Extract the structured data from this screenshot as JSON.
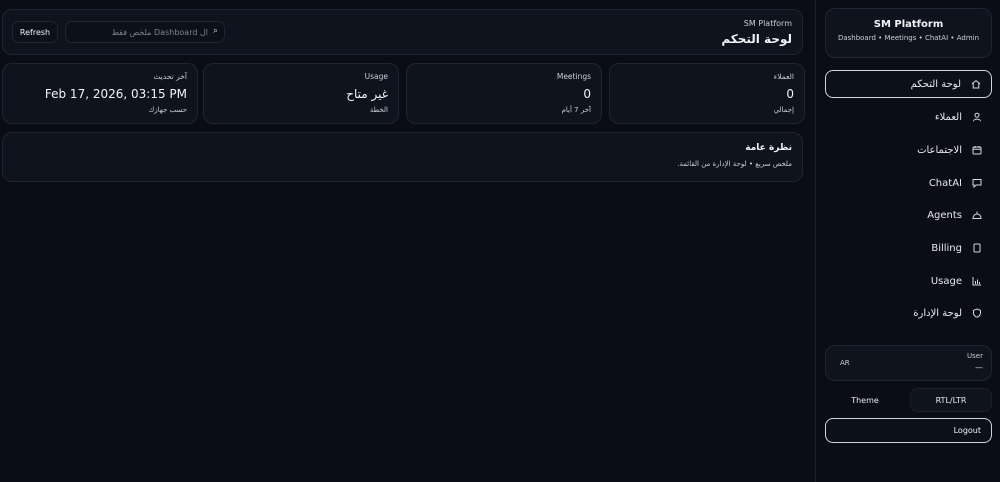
{
  "header": {
    "subtitle": "SM Platform",
    "title": "لوحة التحكم",
    "refresh_label": "Refresh",
    "search_placeholder": "ال Dashboard ملخص فقط"
  },
  "stats": [
    {
      "label": "العملاء",
      "value": "0",
      "sub": "إجمالي"
    },
    {
      "label": "Meetings",
      "value": "0",
      "sub": "آخر 7 أيام"
    },
    {
      "label": "Usage",
      "value": "غير متاح",
      "sub": "الخطة"
    },
    {
      "label": "آخر تحديث",
      "value": "Feb 17, 2026, 03:15 PM",
      "sub": "حسب جهازك"
    }
  ],
  "overview": {
    "title": "نظرة عامة",
    "subtitle": "ملخص سريع • لوحة الإدارة من القائمة."
  },
  "sidebar": {
    "brand_title": "SM Platform",
    "brand_subtitle": "Dashboard • Meetings • ChatAI • Admin",
    "items": [
      {
        "label": "لوحة التحكم",
        "icon": "home-icon"
      },
      {
        "label": "العملاء",
        "icon": "user-icon"
      },
      {
        "label": "الاجتماعات",
        "icon": "calendar-icon"
      },
      {
        "label": "ChatAI",
        "icon": "chat-icon"
      },
      {
        "label": "Agents",
        "icon": "bot-icon"
      },
      {
        "label": "Billing",
        "icon": "billing-icon"
      },
      {
        "label": "Usage",
        "icon": "chart-icon"
      },
      {
        "label": "لوحة الإدارة",
        "icon": "shield-icon"
      }
    ],
    "user_label": "User",
    "user_value": "—",
    "lang_badge": "AR",
    "rtl_ltr_label": "RTL/LTR",
    "theme_label": "Theme",
    "logout_label": "Logout"
  },
  "colors": {
    "background": "#0a0d15",
    "card": "#0f131d",
    "border": "#1f2533",
    "active_border": "#cfd5df",
    "text": "#e6e9ef"
  }
}
